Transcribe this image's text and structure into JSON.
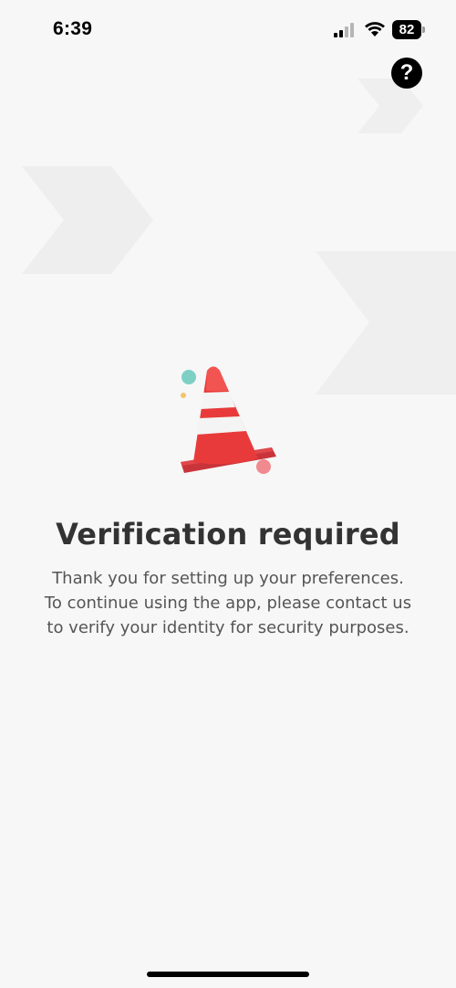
{
  "status_bar": {
    "time": "6:39",
    "battery": "82"
  },
  "help": {
    "icon": "question-mark-icon",
    "label": "?"
  },
  "main": {
    "illustration": "traffic-cone-icon",
    "title": "Verification required",
    "message_lines": [
      "Thank you for setting up your preferences.",
      "To continue using the app, please contact us",
      "to verify your identity for security purposes."
    ]
  },
  "colors": {
    "background": "#f7f7f7",
    "title": "#333333",
    "text": "#555555",
    "cone_red": "#e83a3a",
    "cone_stripe": "#f4f4f4",
    "accent_teal": "#7ecfc4",
    "accent_pink": "#f08a8e"
  }
}
